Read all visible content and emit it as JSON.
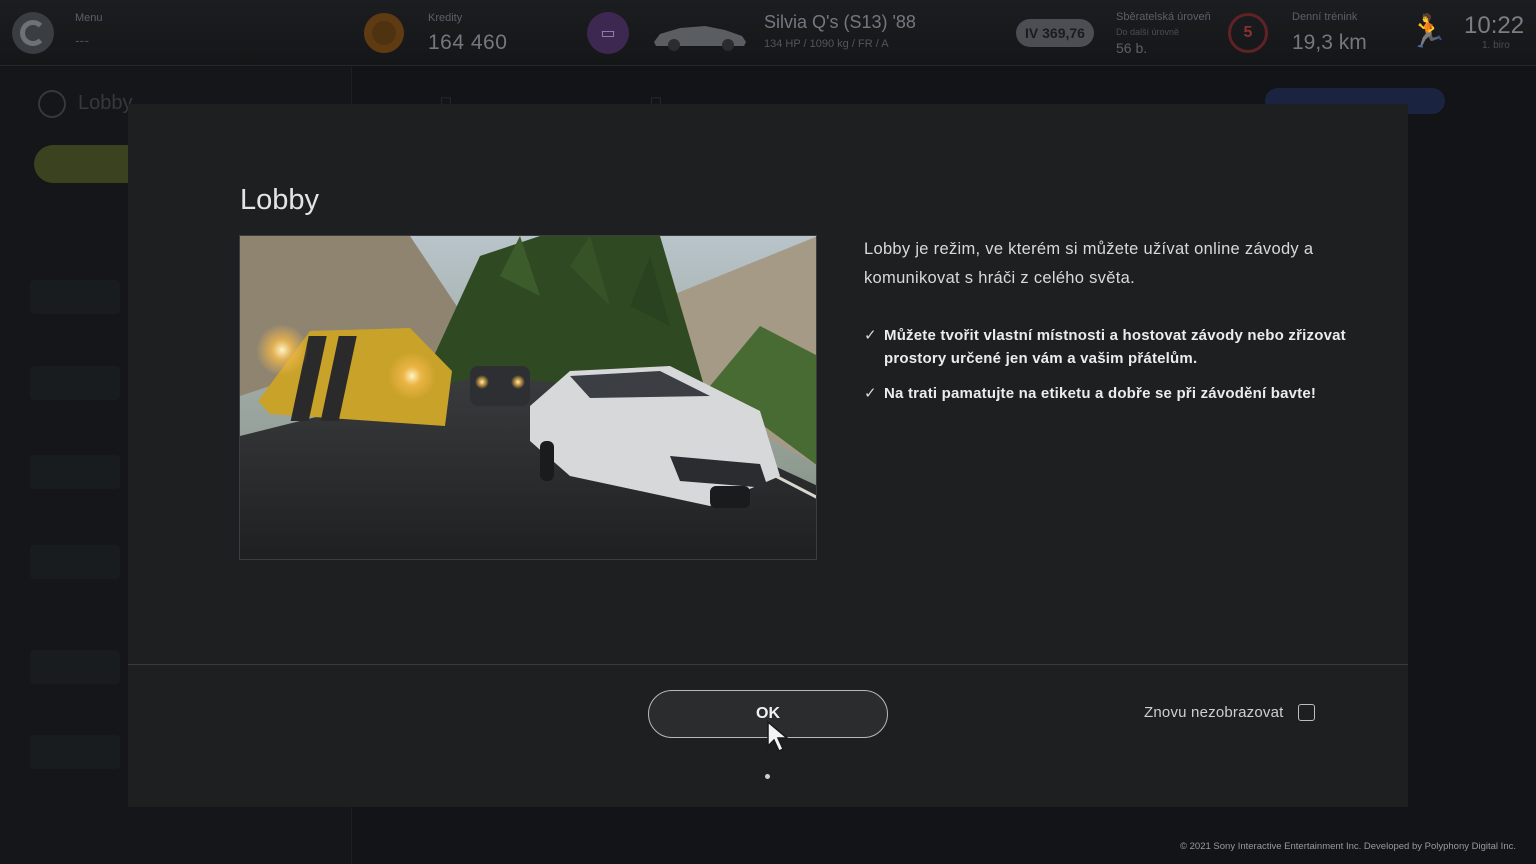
{
  "topbar": {
    "menu_label": "Menu",
    "menu_sub": "---",
    "credits_label": "Kredity",
    "credits_value": "164 460",
    "car_name": "Silvia Q's (S13) '88",
    "car_spec": "134 HP / 1090 kg / FR / A",
    "rating": "IV 369,76",
    "collector_label": "Sběratelská úroveň",
    "collector_sub": "Do další úrovně",
    "collector_points": "56 b.",
    "level": "5",
    "daily_label": "Denní trénink",
    "daily_value": "19,3 km",
    "time": "10:22",
    "time_sub": "1. biro"
  },
  "background": {
    "title": "Lobby"
  },
  "modal": {
    "title": "Lobby",
    "description": "Lobby je režim, ve kterém si můžete užívat online závody a komunikovat s hráči z celého světa.",
    "bullets": [
      "Můžete tvořit vlastní místnosti a hostovat závody nebo zřizovat prostory určené jen vám a vašim přátelům.",
      "Na trati pamatujte na etiketu a dobře se při závodění bavte!"
    ],
    "ok_label": "OK",
    "dont_show_label": "Znovu nezobrazovat",
    "dont_show_checked": false
  },
  "footer": {
    "copyright": "© 2021 Sony Interactive Entertainment Inc. Developed by Polyphony Digital Inc."
  },
  "icons": {
    "logo": "gran-turismo-logo-icon",
    "credits": "credits-coin-icon",
    "garage": "garage-icon",
    "runner": "runner-icon",
    "check": "check-icon",
    "cursor": "pointer-cursor-icon"
  },
  "colors": {
    "modal_bg": "#1e1f21",
    "page_bg": "#121417",
    "accent_level": "#8a3036",
    "text_primary": "#e6e6e6"
  }
}
